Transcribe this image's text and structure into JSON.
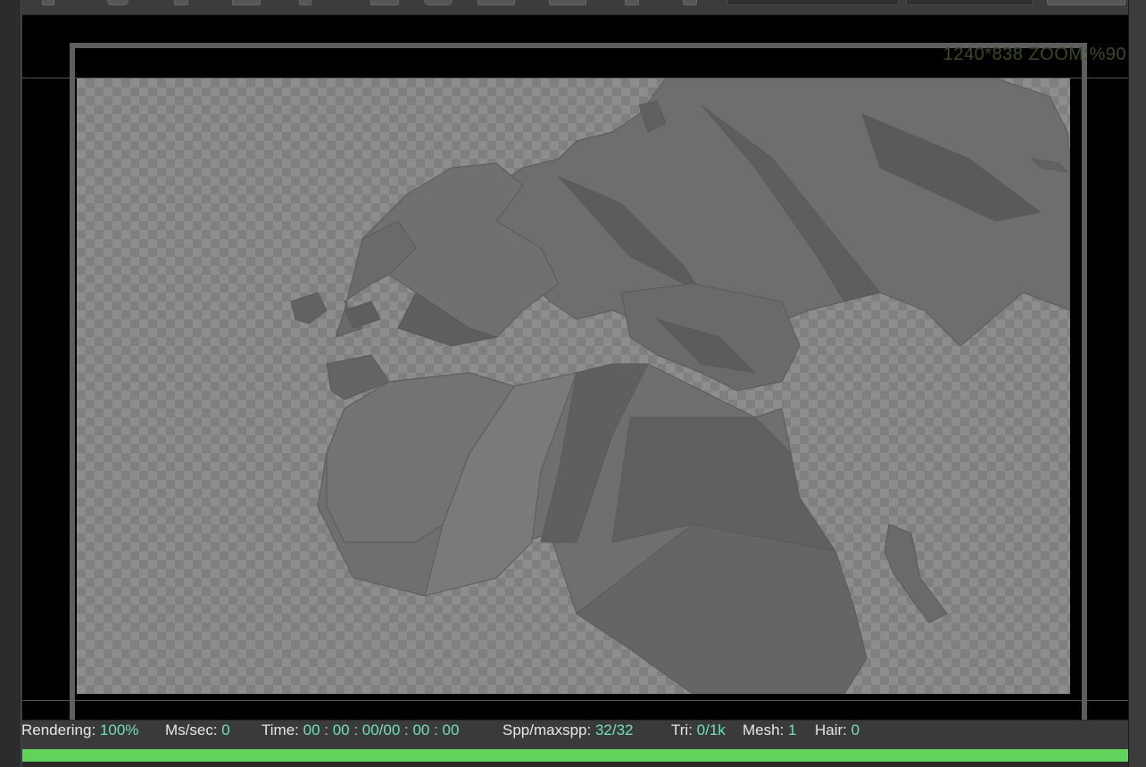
{
  "viewport": {
    "resolution_label": "1240*838 ZOOM:%90"
  },
  "status": {
    "rendering": {
      "label": "Rendering:",
      "value": "100%"
    },
    "ms_sec": {
      "label": "Ms/sec:",
      "value": "0"
    },
    "time": {
      "label": "Time:",
      "value": "00 : 00 : 00/00 : 00 : 00"
    },
    "spp": {
      "label": "Spp/maxspp:",
      "value": "32/32"
    },
    "tri": {
      "label": "Tri:",
      "value": "0/1k"
    },
    "mesh": {
      "label": "Mesh:",
      "value": "1"
    },
    "hair": {
      "label": "Hair:",
      "value": "0"
    }
  },
  "progress": {
    "fraction": 1.0,
    "color": "#5fd35a"
  },
  "colors": {
    "value_text": "#6fe0b8",
    "label_text": "#e6e6e6",
    "checker_light": "#8d8d8d",
    "checker_dark": "#7f7f7f",
    "mesh_gray": "#6c6c6c"
  },
  "icons": [
    "toolbar-icon",
    "toolbar-icon",
    "toolbar-icon",
    "toolbar-icon",
    "toolbar-icon",
    "toolbar-icon",
    "toolbar-icon"
  ]
}
